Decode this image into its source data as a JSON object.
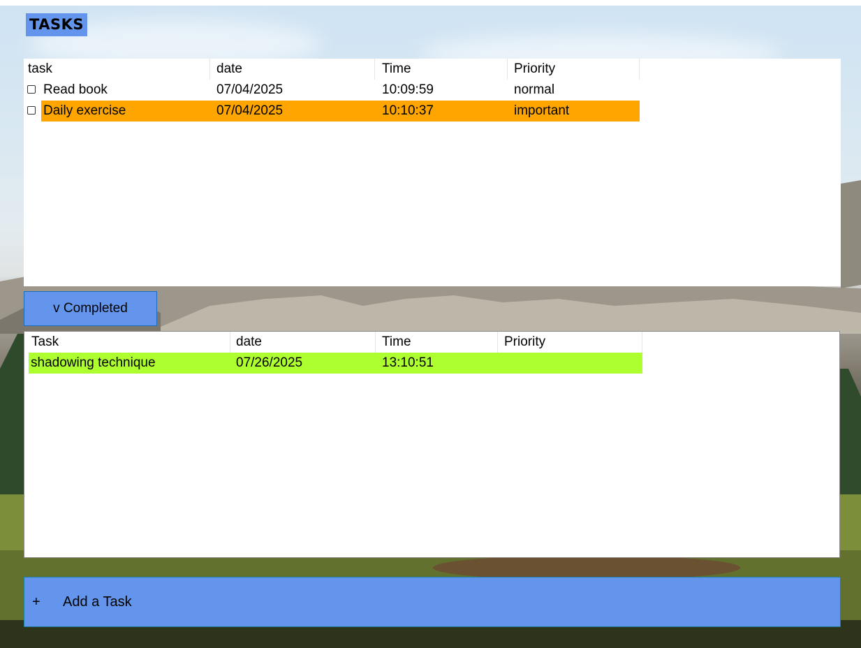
{
  "window": {
    "title": "TASKS"
  },
  "tasks_list": {
    "columns": [
      "task",
      "date",
      "Time",
      "Priority"
    ],
    "rows": [
      {
        "task": "Read book",
        "date": "07/04/2025",
        "time": "10:09:59",
        "priority": "normal",
        "checked": false,
        "highlight": ""
      },
      {
        "task": "Daily exercise",
        "date": "07/04/2025",
        "time": "10:10:37",
        "priority": "important",
        "checked": false,
        "highlight": "#ffa500"
      }
    ]
  },
  "completed_toggle": {
    "label": "v Completed"
  },
  "completed_list": {
    "columns": [
      "Task",
      "date",
      "Time",
      "Priority"
    ],
    "rows": [
      {
        "task": "shadowing technique",
        "date": "07/26/2025",
        "time": "13:10:51",
        "priority": "",
        "highlight": "#adff2f"
      }
    ]
  },
  "add_task": {
    "icon": "+",
    "label": "Add a Task"
  },
  "colors": {
    "accent": "#6495ed",
    "important_row": "#ffa500",
    "completed_row": "#adff2f"
  }
}
